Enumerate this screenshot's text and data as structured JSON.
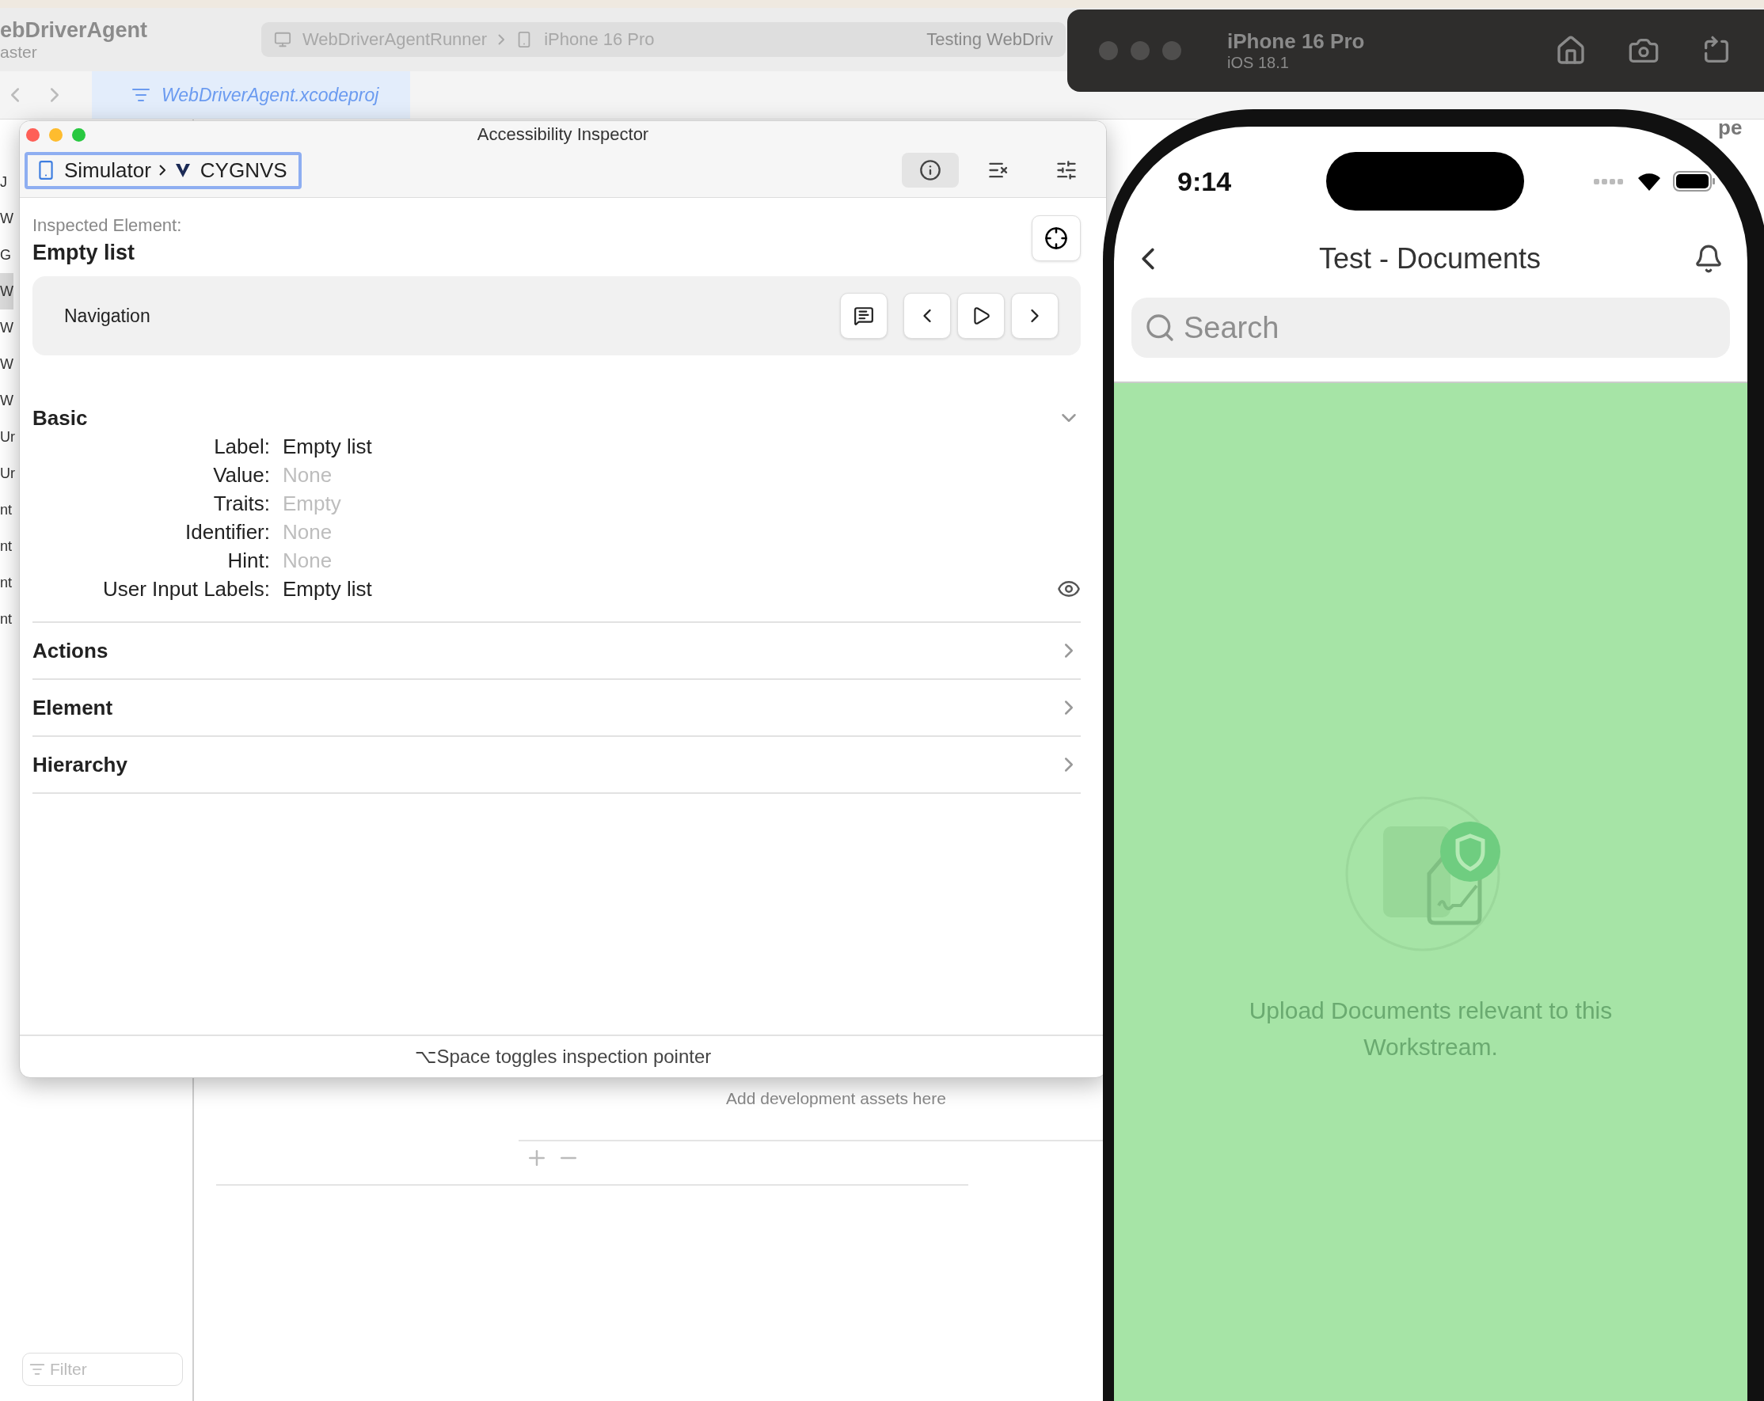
{
  "xcode": {
    "project_title": "ebDriverAgent",
    "branch": "aster",
    "scheme": "WebDriverAgentRunner",
    "destination": "iPhone 16 Pro",
    "status": "Testing WebDriv",
    "tab": {
      "label": "WebDriverAgent.xcodeproj",
      "selected": true
    },
    "sidebar_items": [
      {
        "label": "J",
        "selected": false
      },
      {
        "label": "W",
        "selected": false
      },
      {
        "label": "G",
        "selected": false
      },
      {
        "label": "W",
        "selected": true
      },
      {
        "label": "W",
        "selected": false
      },
      {
        "label": "W",
        "selected": false
      },
      {
        "label": "W",
        "selected": false
      },
      {
        "label": "Ur",
        "selected": false
      },
      {
        "label": "Ur",
        "selected": false
      },
      {
        "label": "nt",
        "selected": false
      },
      {
        "label": "nt",
        "selected": false
      },
      {
        "label": "nt",
        "selected": false
      },
      {
        "label": "nt",
        "selected": false
      }
    ],
    "fragment": "pe",
    "assets_hint": "Add development assets here",
    "filter": {
      "placeholder": "Filter"
    }
  },
  "inspector": {
    "title": "Accessibility Inspector",
    "target": {
      "app": "Simulator",
      "element": "CYGNVS"
    },
    "toolbar": [
      {
        "kind": "info",
        "selected": true
      },
      {
        "kind": "audit",
        "selected": false
      },
      {
        "kind": "settings",
        "selected": false
      }
    ],
    "heading": "Inspected Element:",
    "element_name": "Empty list",
    "navigation": {
      "label": "Navigation"
    },
    "sections": [
      {
        "title": "Basic",
        "expanded": true,
        "fields": [
          {
            "label": "Label:",
            "value": "Empty list",
            "muted": false
          },
          {
            "label": "Value:",
            "value": "None",
            "muted": true
          },
          {
            "label": "Traits:",
            "value": "Empty",
            "muted": true
          },
          {
            "label": "Identifier:",
            "value": "None",
            "muted": true
          },
          {
            "label": "Hint:",
            "value": "None",
            "muted": true
          },
          {
            "label": "User Input Labels:",
            "value": "Empty list",
            "muted": false
          }
        ]
      },
      {
        "title": "Actions",
        "expanded": false
      },
      {
        "title": "Element",
        "expanded": false
      },
      {
        "title": "Hierarchy",
        "expanded": false
      }
    ],
    "footer": "⌥Space toggles inspection pointer"
  },
  "simulator": {
    "device": "iPhone 16 Pro",
    "os": "iOS 18.1",
    "time": "9:14",
    "screen_title": "Test - Documents",
    "search": {
      "placeholder": "Search"
    },
    "empty_message": "Upload Documents relevant to this Workstream."
  }
}
